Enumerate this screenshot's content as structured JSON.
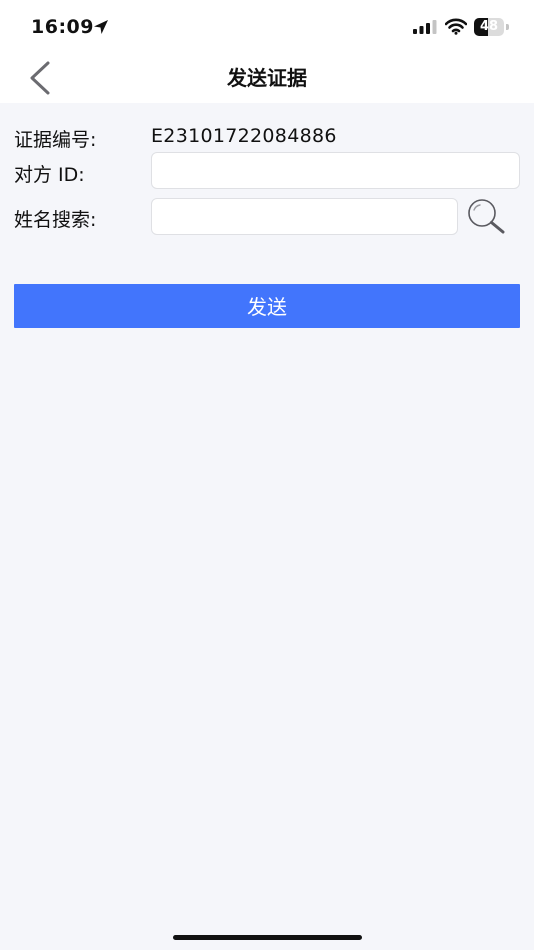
{
  "status_bar": {
    "time": "16:09",
    "battery_level": "48",
    "battery_fraction": 0.48
  },
  "nav": {
    "title": "发送证据"
  },
  "form": {
    "evidence_no_label": "证据编号:",
    "evidence_no_value": "E23101722084886",
    "peer_id_label": "对方 ID:",
    "peer_id_value": "",
    "name_search_label": "姓名搜索:",
    "name_search_value": ""
  },
  "actions": {
    "send_label": "发送"
  },
  "icons": {
    "back": "chevron-left-icon",
    "search": "magnifier-icon",
    "location": "location-arrow-icon",
    "signal": "cellular-signal-icon",
    "wifi": "wifi-icon",
    "battery": "battery-icon"
  },
  "colors": {
    "primary": "#4275fc",
    "background": "#f5f6fa",
    "header": "#ffffff"
  }
}
